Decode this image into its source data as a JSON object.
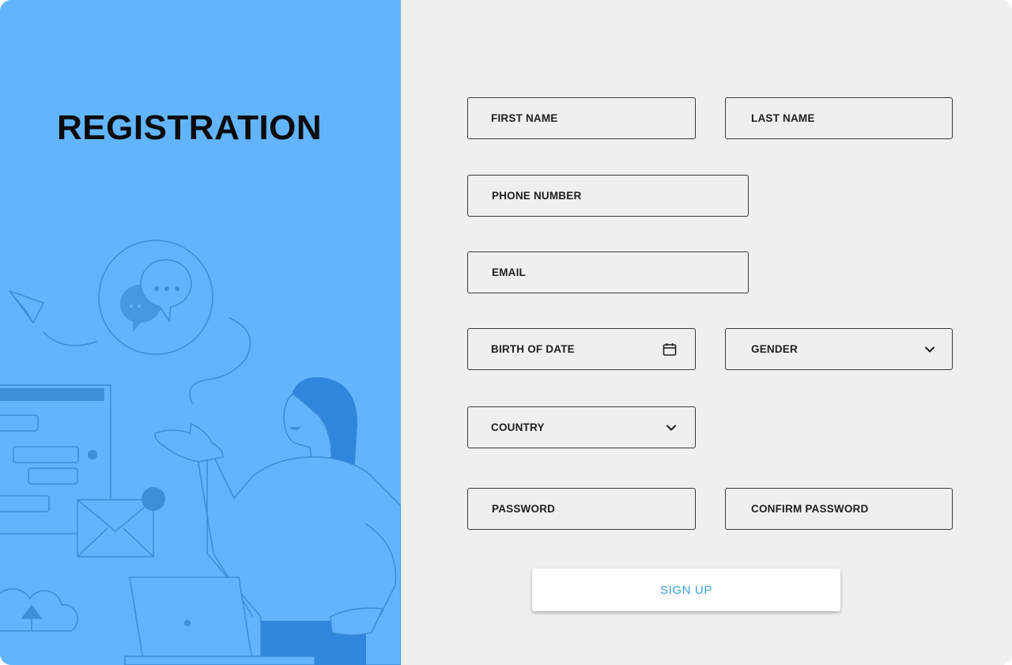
{
  "page": {
    "title": "REGISTRATION"
  },
  "form": {
    "first_name": "FIRST NAME",
    "last_name": "LAST NAME",
    "phone_number": "PHONE NUMBER",
    "email": "EMAIL",
    "birth_date": "BIRTH OF DATE",
    "gender": "GENDER",
    "country": "COUNTRY",
    "password": "PASSWORD",
    "confirm_password": "CONFIRM PASSWORD",
    "signup_label": "SIGN UP"
  },
  "icons": {
    "birth_date": "calendar-icon",
    "gender": "chevron-down-icon",
    "country": "chevron-down-icon"
  },
  "colors": {
    "left_panel": "#62b5fc",
    "illustration_dark": "#3a8be0",
    "background": "#efefef",
    "button_text": "#3b9fe6"
  }
}
